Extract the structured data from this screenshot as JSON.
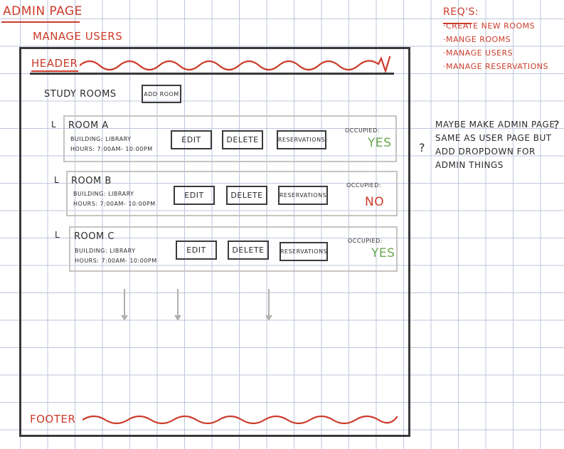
{
  "sketch": {
    "title": "ADMIN PAGE",
    "subtitle": "MANAGE USERS"
  },
  "requirements": {
    "title": "REQ'S:",
    "items": [
      "·CREATE NEW ROOMS",
      "·MANGE ROOMS",
      "·MANAGE USERS",
      "·MANAGE RESERVATIONS"
    ]
  },
  "note": {
    "text": "MAYBE MAKE ADMIN PAGE SAME AS USER PAGE BUT ADD DROPDOWN FOR ADMIN THINGS",
    "question_marks": [
      "?",
      "?"
    ]
  },
  "page": {
    "header_label": "HEADER",
    "footer_label": "FOOTER",
    "section_title": "STUDY ROOMS",
    "add_room_label": "ADD ROOM",
    "branch_glyph": "L",
    "rooms": [
      {
        "name": "ROOM A",
        "building": "BUILDING: LIBRARY",
        "hours": "HOURS: 7:00AM- 10:00PM",
        "edit_label": "EDIT",
        "delete_label": "DELETE",
        "reservations_label": "RESERVATIONS",
        "occupied_label": "OCCUPIED:",
        "occupied_value": "YES"
      },
      {
        "name": "ROOM B",
        "building": "BUILDING: LIBRARY",
        "hours": "HOURS: 7:00AM- 10:00PM",
        "edit_label": "EDIT",
        "delete_label": "DELETE",
        "reservations_label": "RESERVATIONS",
        "occupied_label": "OCCUPIED:",
        "occupied_value": "NO"
      },
      {
        "name": "ROOM C",
        "building": "BUILDING: LIBRARY",
        "hours": "HOURS: 7:00AM- 10:00PM",
        "edit_label": "EDIT",
        "delete_label": "DELETE",
        "reservations_label": "RESERVATIONS",
        "occupied_label": "OCCUPIED:",
        "occupied_value": "YES"
      }
    ]
  },
  "colors": {
    "annotation_red": "#cc3b2a",
    "occupied_yes": "#6aa84f",
    "occupied_no": "#cc3b2a",
    "ink": "#2b2b2b",
    "card_border": "#c7c3c0",
    "grid": "#bcc6dc"
  }
}
